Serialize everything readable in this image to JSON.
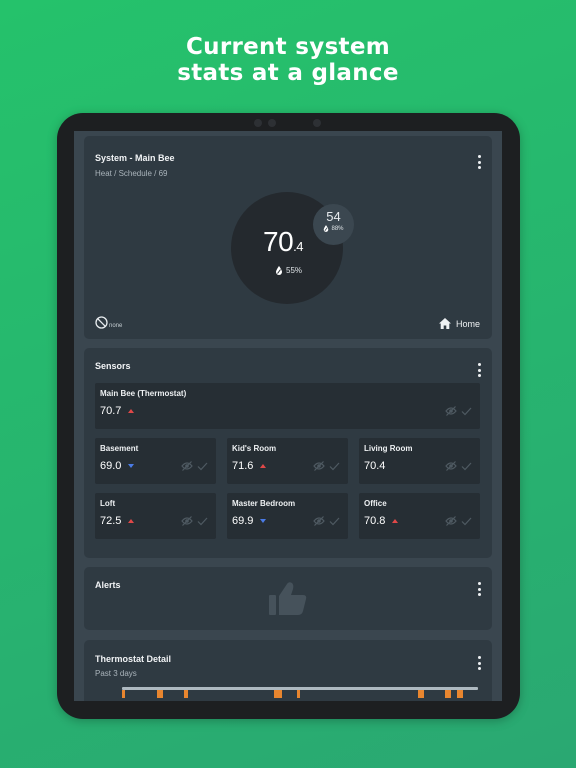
{
  "headline": {
    "line1": "Current system",
    "line2": "stats at a glance"
  },
  "system_card": {
    "title": "System - Main Bee",
    "subtitle": "Heat / Schedule / 69",
    "current_temp": "70",
    "current_temp_decimal": ".4",
    "current_humidity": "55%",
    "setpoint_temp": "54",
    "setpoint_humidity": "88%",
    "fan_label": "none",
    "comfort_label": "Home",
    "icons": {
      "humidity": "humidity-drop-icon",
      "fan": "fan-off-icon",
      "comfort": "home-icon",
      "menu": "kebab-menu-icon"
    }
  },
  "sensors_card": {
    "title": "Sensors",
    "main_sensor": {
      "name": "Main Bee (Thermostat)",
      "value": "70.7",
      "trend": "up"
    },
    "sensors": [
      {
        "name": "Basement",
        "value": "69.0",
        "trend": "down"
      },
      {
        "name": "Kid's Room",
        "value": "71.6",
        "trend": "up"
      },
      {
        "name": "Living Room",
        "value": "70.4",
        "trend": "none"
      },
      {
        "name": "Loft",
        "value": "72.5",
        "trend": "up"
      },
      {
        "name": "Master Bedroom",
        "value": "69.9",
        "trend": "down"
      },
      {
        "name": "Office",
        "value": "70.8",
        "trend": "up"
      }
    ],
    "icons": {
      "hide": "eye-off-icon",
      "participate": "check-icon",
      "trend_up": "arrow-up-icon",
      "trend_down": "arrow-down-icon"
    }
  },
  "alerts_card": {
    "title": "Alerts",
    "empty_icon": "thumbs-up-icon"
  },
  "detail_card": {
    "title": "Thermostat Detail",
    "subtitle": "Past 3 days"
  },
  "colors": {
    "accent_green": "#25c26b",
    "up_arrow": "#e04848",
    "down_arrow": "#4a7be6",
    "chart_mark": "#e9862f"
  }
}
